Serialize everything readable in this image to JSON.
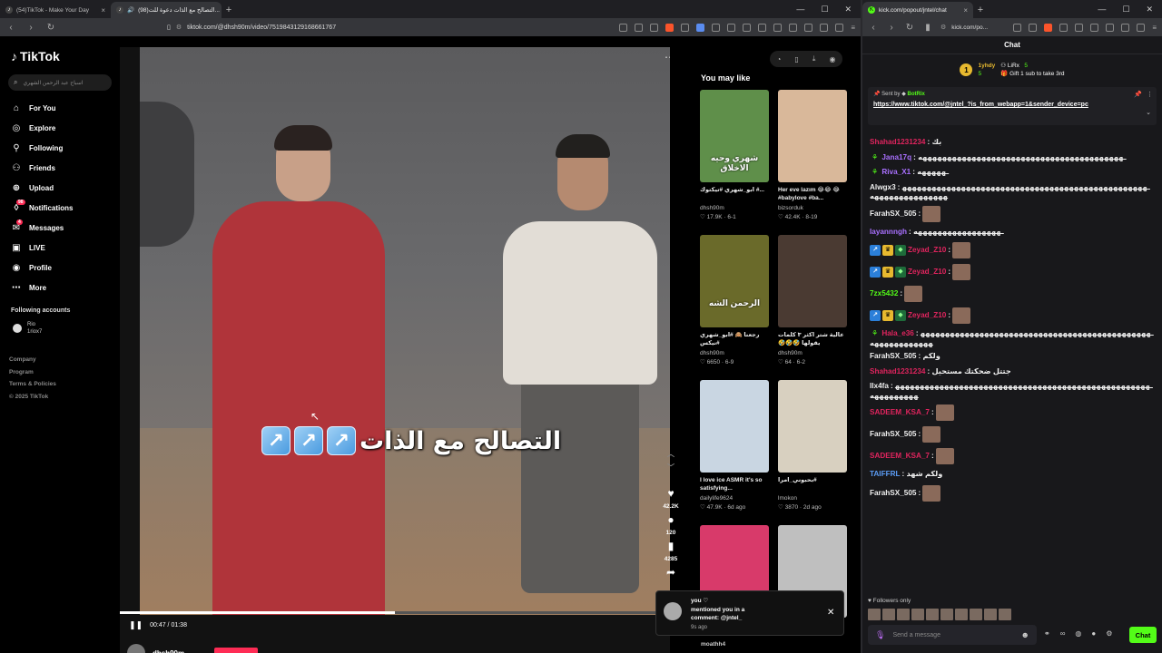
{
  "left_browser": {
    "tabs": [
      {
        "title": "(54)TikTok - Make Your Day",
        "active": false
      },
      {
        "title": "(98)التصالح مع الذات دعوة للت...",
        "active": true
      }
    ],
    "url": "tiktok.com/@dhsh90m/video/7519843129168661767"
  },
  "tiktok": {
    "logo": "TikTok",
    "search_placeholder": "اسباح عبد الرحمن الشهري",
    "nav": [
      {
        "label": "For You",
        "icon": "home-icon"
      },
      {
        "label": "Explore",
        "icon": "compass-icon"
      },
      {
        "label": "Following",
        "icon": "following-icon"
      },
      {
        "label": "Friends",
        "icon": "friends-icon"
      },
      {
        "label": "Upload",
        "icon": "upload-icon"
      },
      {
        "label": "Notifications",
        "icon": "bell-icon",
        "badge": "98"
      },
      {
        "label": "Messages",
        "icon": "message-icon",
        "badge": "4"
      },
      {
        "label": "LIVE",
        "icon": "live-icon"
      },
      {
        "label": "Profile",
        "icon": "profile-icon"
      },
      {
        "label": "More",
        "icon": "more-icon"
      }
    ],
    "following_title": "Following accounts",
    "following": [
      {
        "name": "Rio",
        "handle": "1riox7"
      }
    ],
    "footer": [
      "Company",
      "Program",
      "Terms & Policies",
      "© 2025 TikTok"
    ],
    "video": {
      "caption": "التصالح مع الذات",
      "time": "00:47 / 01:38",
      "progress": 0.5,
      "author": "dhsh90m"
    },
    "actions": {
      "likes": "42.2K",
      "comments": "120",
      "saves": "4285"
    },
    "you_may_like_title": "You may like",
    "recommendations": [
      {
        "title": "ابو_شهري #تيكتوك #...",
        "author": "dhsh90m",
        "meta": "♡ 17.9K · 6-1",
        "color": "#5f8f4a",
        "overlay": "شهري وحيه الاخلاق"
      },
      {
        "title": "Her eve lazım 😂😂 😂 #babylove #ba...",
        "author": "bizsorduk",
        "meta": "♡ 42.4K · 8-19",
        "color": "#d9b89a",
        "overlay": ""
      },
      {
        "title": "رجعنا 🙈 #ابو_شهري #نيكس #عبدالرحمن_الشهري",
        "author": "dhsh90m",
        "meta": "♡ 6650 · 6-9",
        "color": "#6a6a2a",
        "overlay": "الرحمن الشه"
      },
      {
        "title": "عالية شتر اكثر ٣ كلمات يقولها 🤣🤣🤣 ابو_شهري",
        "author": "dhsh90m",
        "meta": "♡ 64 · 6-2",
        "color": "#4a3a32",
        "overlay": ""
      },
      {
        "title": "I love ice ASMR it's so satisfying...",
        "author": "dailylife9624",
        "meta": "♡ 47.9K · 6d ago",
        "color": "#c9d6e2",
        "overlay": ""
      },
      {
        "title": "بحبوني_امرا#",
        "author": "lmokon",
        "meta": "♡ 3870 · 2d ago",
        "color": "#d8d0c0",
        "overlay": ""
      },
      {
        "title": "",
        "author": "",
        "meta": "",
        "color": "#d83a6a",
        "overlay": ""
      },
      {
        "title": "",
        "author": "",
        "meta": "",
        "color": "#bfbfbf",
        "overlay": ""
      }
    ],
    "toast": {
      "line1": "you ♡",
      "line2": "mentioned you in a",
      "line3": "comment: @jntel_",
      "time": "9s ago"
    },
    "below_toast": "moathh4"
  },
  "right_browser": {
    "tab_title": "kick.com/popout/jntel/chat",
    "url": "kick.com/po...",
    "chat_header": "Chat",
    "leaderboard": {
      "rank": "1",
      "first_name": "1yhdy",
      "first_count": "5",
      "second_name": "LiRx",
      "second_count": "5",
      "gift_text": "Gift 1 sub to take 3rd"
    },
    "pinned": {
      "sent_by_label": "Sent by",
      "sender": "BotRix",
      "link": "https://www.tiktok.com/@jntel_?is_from_webapp=1&sender_device=pc"
    },
    "messages": [
      {
        "user": "Shahad1231234",
        "color": "#e0245e",
        "text": "بك",
        "badges": [],
        "emotes": 0
      },
      {
        "user": "Jana17q",
        "color": "#a970ff",
        "text": "ـهههههههههههههههههههههههههههههههههههههههههه",
        "badges": [
          "gift"
        ],
        "emotes": 0
      },
      {
        "user": "Riva_X1",
        "color": "#a970ff",
        "text": "ـهههههه",
        "badges": [
          "gift"
        ],
        "emotes": 0
      },
      {
        "user": "Alwgx3",
        "color": "#eeeeee",
        "text": "ـهههههههههههههههههههههههههههههههههههههههههههههههههههههههههههههههههه",
        "badges": [],
        "emotes": 0
      },
      {
        "user": "FarahSX_505",
        "color": "#eeeeee",
        "text": "",
        "badges": [],
        "emotes": 1
      },
      {
        "user": "layannngh",
        "color": "#a970ff",
        "text": "ـهههههههههههههههههه",
        "badges": [],
        "emotes": 0
      },
      {
        "user": "Zeyad_Z10",
        "color": "#e0245e",
        "text": "",
        "badges": [
          "blue",
          "crown",
          "green"
        ],
        "emotes": 1
      },
      {
        "user": "Zeyad_Z10",
        "color": "#e0245e",
        "text": "",
        "badges": [
          "blue",
          "crown",
          "green"
        ],
        "emotes": 1
      },
      {
        "user": "7zx5432",
        "color": "#53fc18",
        "text": "",
        "badges": [],
        "emotes": 1
      },
      {
        "user": "Zeyad_Z10",
        "color": "#e0245e",
        "text": "",
        "badges": [
          "blue",
          "crown",
          "green"
        ],
        "emotes": 1
      },
      {
        "user": "Hala_e36",
        "color": "#e0245e",
        "text": "ـهههههههههههههههههههههههههههههههههههههههههههههههههههههههههههه",
        "badges": [
          "gift"
        ],
        "emotes": 0
      },
      {
        "user": "FarahSX_505",
        "color": "#eeeeee",
        "text": "ولكم",
        "badges": [],
        "emotes": 0
      },
      {
        "user": "Shahad1231234",
        "color": "#e0245e",
        "text": "جتتل ضحكتك مستحيل",
        "badges": [],
        "emotes": 0
      },
      {
        "user": "llx4fa",
        "color": "#eeeeee",
        "text": "ـهههههههههههههههههههههههههههههههههههههههههههههههههههههههههههههه",
        "badges": [],
        "emotes": 0
      },
      {
        "user": "SADEEM_KSA_7",
        "color": "#e0245e",
        "text": "",
        "badges": [],
        "emotes": 1
      },
      {
        "user": "FarahSX_505",
        "color": "#eeeeee",
        "text": "",
        "badges": [],
        "emotes": 1
      },
      {
        "user": "SADEEM_KSA_7",
        "color": "#e0245e",
        "text": "",
        "badges": [],
        "emotes": 1
      },
      {
        "user": "TAIFFRL",
        "color": "#5b9cf5",
        "text": "ولكم شهد",
        "badges": [],
        "emotes": 0
      },
      {
        "user": "FarahSX_505",
        "color": "#eeeeee",
        "text": "",
        "badges": [],
        "emotes": 1
      }
    ],
    "followers_only": "Followers only",
    "composer_placeholder": "Send a message",
    "chat_button": "Chat"
  }
}
